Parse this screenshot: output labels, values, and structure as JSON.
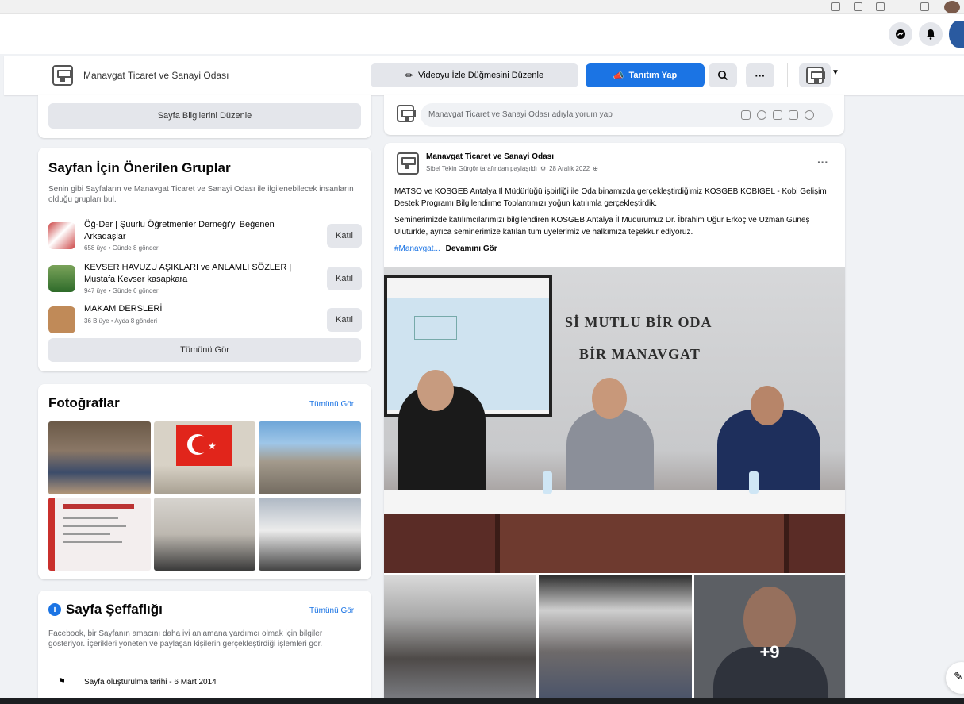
{
  "header": {
    "page_name": "Manavgat Ticaret ve Sanayi Odası",
    "edit_button_label": "Videoyu İzle Düğmesini Düzenle",
    "promote_button_label": "Tanıtım Yap",
    "more_label": "···"
  },
  "left": {
    "edit_info_label": "Sayfa Bilgilerini Düzenle",
    "groups": {
      "title": "Sayfan İçin Önerilen Gruplar",
      "description": "Senin gibi Sayfaların ve Manavgat Ticaret ve Sanayi Odası ile ilgilenebilecek insanların olduğu grupları bul.",
      "join_label": "Katıl",
      "see_all_label": "Tümünü Gör",
      "items": [
        {
          "name": "Öğ-Der | Şuurlu Öğretmenler Derneği'yi Beğenen Arkadaşlar",
          "meta": "658 üye • Günde 8 gönderi"
        },
        {
          "name": "KEVSER HAVUZU AŞIKLARI ve ANLAMLI SÖZLER | Mustafa Kevser kasapkara",
          "meta": "947 üye • Günde 6 gönderi"
        },
        {
          "name": "MAKAM DERSLERİ",
          "meta": "36 B üye • Ayda 8 gönderi"
        }
      ]
    },
    "photos": {
      "title": "Fotoğraflar",
      "see_all_label": "Tümünü Gör"
    },
    "transparency": {
      "title": "Sayfa Şeffaflığı",
      "see_all_label": "Tümünü Gör",
      "description": "Facebook, bir Sayfanın amacını daha iyi anlamana yardımcı olmak için bilgiler gösteriyor. İçerikleri yöneten ve paylaşan kişilerin gerçekleştirdiği işlemleri gör.",
      "created_label": "Sayfa oluşturulma tarihi - 6 Mart 2014"
    }
  },
  "composer": {
    "placeholder": "Manavgat Ticaret ve Sanayi Odası adıyla yorum yap"
  },
  "post": {
    "author": "Manavgat Ticaret ve Sanayi Odası",
    "meta": "Sibel Tekin Gürgör tarafından paylaşıldı",
    "date": "28 Aralık 2022",
    "paragraph1": "MATSO ve KOSGEB Antalya İl Müdürlüğü işbirliği ile Oda binamızda gerçekleştirdiğimiz KOSGEB KOBİGEL - Kobi Gelişim Destek Programı Bilgilendirme Toplantımızı yoğun katılımla gerçekleştirdik.",
    "paragraph2": "Seminerimizde katılımcılarımızı bilgilendiren KOSGEB Antalya İl Müdürümüz Dr. İbrahim Uğur Erkoç ve Uzman Güneş Ulutürkle, ayrıca seminerimize katılan tüm üyelerimiz ve halkımıza teşekkür ediyoruz.",
    "hashtag": "#Manavgat...",
    "more_label": "Devamını Gör",
    "banner_line1": "Sİ MUTLU BİR ODA",
    "banner_line2": "BİR MANAVGAT",
    "more_photos": "+9"
  },
  "colors": {
    "accent": "#1b74e4",
    "background": "#f0f2f5",
    "card": "#ffffff",
    "button_gray": "#e4e6eb"
  }
}
